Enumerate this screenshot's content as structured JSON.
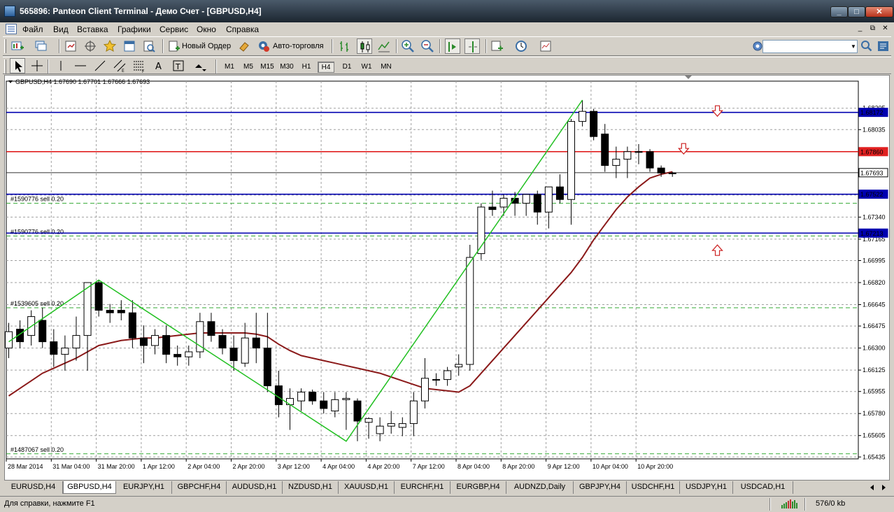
{
  "window": {
    "title": "565896: Panteon Client Terminal - Демо Счет - [GBPUSD,H4]",
    "minimize": "_",
    "maximize": "□",
    "close": "✕"
  },
  "menu": {
    "items": [
      "Файл",
      "Вид",
      "Вставка",
      "Графики",
      "Сервис",
      "Окно",
      "Справка"
    ],
    "mdi": {
      "minimize": "_",
      "restore": "⧉",
      "close": "✕"
    }
  },
  "toolbar": {
    "new_order": "Новый Ордер",
    "auto_trading": "Авто-торговля",
    "search_value": "",
    "timeframes": [
      "M1",
      "M5",
      "M15",
      "M30",
      "H1",
      "H4",
      "D1",
      "W1",
      "MN"
    ],
    "active_timeframe": "H4"
  },
  "chart": {
    "header": "GBPUSD,H4  1.67690 1.67701 1.67666 1.67693",
    "symbol": "GBPUSD",
    "timeframe": "H4",
    "ohlc": {
      "open": 1.6769,
      "high": 1.67701,
      "low": 1.67666,
      "close": 1.67693
    },
    "colors": {
      "bull": "#ffffff",
      "bear": "#000000",
      "ma": "#8b1a1a",
      "zigzag": "#22c022",
      "blue_level": "#0000b0",
      "red_level": "#e02020",
      "order_level": "#33aa33",
      "arrow": "#cc2222"
    },
    "y_min": 1.6542,
    "y_max": 1.6842,
    "price_ticks": [
      "1.68205",
      "1.68035",
      "1.67515",
      "1.67340",
      "1.67165",
      "1.66995",
      "1.66820",
      "1.66645",
      "1.66475",
      "1.66300",
      "1.66125",
      "1.65955",
      "1.65780",
      "1.65605",
      "1.65435"
    ],
    "time_labels": [
      "28 Mar 2014",
      "31 Mar 04:00",
      "31 Mar 20:00",
      "1 Apr 12:00",
      "2 Apr 04:00",
      "2 Apr 20:00",
      "3 Apr 12:00",
      "4 Apr 04:00",
      "4 Apr 20:00",
      "7 Apr 12:00",
      "8 Apr 04:00",
      "8 Apr 20:00",
      "9 Apr 12:00",
      "10 Apr 04:00",
      "10 Apr 20:00"
    ],
    "levels": [
      {
        "price": 1.68172,
        "label": "1.68172",
        "color": "#0000b0"
      },
      {
        "price": 1.6786,
        "label": "1.67860",
        "color": "#e02020"
      },
      {
        "price": 1.67693,
        "label": "1.67693",
        "color": "#333333"
      },
      {
        "price": 1.67522,
        "label": "1.67522",
        "color": "#0000b0"
      },
      {
        "price": 1.67213,
        "label": "1.67213",
        "color": "#0000b0"
      }
    ],
    "orders": [
      {
        "price": 1.6745,
        "label": "#1590776 sell 0.20"
      },
      {
        "price": 1.6719,
        "label": "#1590776 sell 0.20"
      },
      {
        "price": 1.6662,
        "label": "#1539605 sell 0.20"
      },
      {
        "price": 1.6546,
        "label": "#1487067 sell 0.20"
      }
    ],
    "arrows": [
      {
        "bar": 63,
        "price": 1.6818,
        "dir": "down"
      },
      {
        "bar": 60,
        "price": 1.6788,
        "dir": "down"
      },
      {
        "bar": 63,
        "price": 1.6708,
        "dir": "up"
      }
    ]
  },
  "chart_data": {
    "type": "candlestick",
    "candles": [
      [
        1.663,
        1.665,
        1.6622,
        1.6643
      ],
      [
        1.6645,
        1.6652,
        1.663,
        1.6635
      ],
      [
        1.664,
        1.666,
        1.6632,
        1.6655
      ],
      [
        1.6652,
        1.6662,
        1.663,
        1.6635
      ],
      [
        1.6635,
        1.6645,
        1.6615,
        1.6625
      ],
      [
        1.6625,
        1.664,
        1.6612,
        1.663
      ],
      [
        1.663,
        1.6655,
        1.662,
        1.664
      ],
      [
        1.664,
        1.668,
        1.6612,
        1.6682
      ],
      [
        1.6682,
        1.6684,
        1.6655,
        1.666
      ],
      [
        1.666,
        1.6665,
        1.665,
        1.6658
      ],
      [
        1.666,
        1.6668,
        1.6652,
        1.6658
      ],
      [
        1.6658,
        1.6668,
        1.663,
        1.6638
      ],
      [
        1.6638,
        1.6648,
        1.6618,
        1.6632
      ],
      [
        1.6632,
        1.6645,
        1.6625,
        1.664
      ],
      [
        1.664,
        1.6648,
        1.6618,
        1.6625
      ],
      [
        1.6625,
        1.6632,
        1.6616,
        1.6623
      ],
      [
        1.6623,
        1.6632,
        1.6616,
        1.6627
      ],
      [
        1.6627,
        1.6658,
        1.6622,
        1.6651
      ],
      [
        1.6651,
        1.6658,
        1.6635,
        1.664
      ],
      [
        1.664,
        1.6645,
        1.6625,
        1.663
      ],
      [
        1.663,
        1.664,
        1.6612,
        1.662
      ],
      [
        1.6618,
        1.665,
        1.6615,
        1.6638
      ],
      [
        1.6638,
        1.6658,
        1.6618,
        1.663
      ],
      [
        1.663,
        1.6658,
        1.6595,
        1.66
      ],
      [
        1.66,
        1.6612,
        1.6575,
        1.6585
      ],
      [
        1.6585,
        1.6598,
        1.6565,
        1.659
      ],
      [
        1.6588,
        1.6598,
        1.658,
        1.6595
      ],
      [
        1.6595,
        1.6597,
        1.6585,
        1.6588
      ],
      [
        1.6588,
        1.6595,
        1.6578,
        1.6582
      ],
      [
        1.658,
        1.6595,
        1.6575,
        1.6589
      ],
      [
        1.6589,
        1.6595,
        1.6565,
        1.659
      ],
      [
        1.6588,
        1.659,
        1.6556,
        1.6572
      ],
      [
        1.6571,
        1.6575,
        1.6558,
        1.6574
      ],
      [
        1.6562,
        1.6575,
        1.6556,
        1.6568
      ],
      [
        1.6568,
        1.658,
        1.6562,
        1.657
      ],
      [
        1.6567,
        1.6575,
        1.656,
        1.657
      ],
      [
        1.657,
        1.6595,
        1.656,
        1.6588
      ],
      [
        1.6588,
        1.6622,
        1.6582,
        1.6606
      ],
      [
        1.6605,
        1.661,
        1.66,
        1.6605
      ],
      [
        1.6605,
        1.6615,
        1.66,
        1.6612
      ],
      [
        1.6615,
        1.6625,
        1.6608,
        1.6617
      ],
      [
        1.6617,
        1.6712,
        1.6612,
        1.6702
      ],
      [
        1.6705,
        1.6745,
        1.67,
        1.6742
      ],
      [
        1.6742,
        1.6755,
        1.6735,
        1.674
      ],
      [
        1.6742,
        1.6752,
        1.6735,
        1.6749
      ],
      [
        1.6749,
        1.6754,
        1.6735,
        1.6745
      ],
      [
        1.6745,
        1.6752,
        1.6735,
        1.6752
      ],
      [
        1.6752,
        1.6755,
        1.6728,
        1.6738
      ],
      [
        1.6738,
        1.6758,
        1.6725,
        1.6758
      ],
      [
        1.6758,
        1.6768,
        1.6745,
        1.6748
      ],
      [
        1.6748,
        1.6812,
        1.6728,
        1.681
      ],
      [
        1.681,
        1.6827,
        1.6806,
        1.6818
      ],
      [
        1.6818,
        1.682,
        1.6795,
        1.6798
      ],
      [
        1.68,
        1.6808,
        1.677,
        1.6775
      ],
      [
        1.6775,
        1.679,
        1.6765,
        1.678
      ],
      [
        1.678,
        1.679,
        1.6765,
        1.6786
      ],
      [
        1.6786,
        1.6792,
        1.6776,
        1.6786
      ],
      [
        1.6786,
        1.6788,
        1.677,
        1.6773
      ],
      [
        1.6773,
        1.6775,
        1.6766,
        1.6769
      ],
      [
        1.6769,
        1.677,
        1.6766,
        1.6769
      ]
    ],
    "ma": [
      1.6592,
      1.6598,
      1.6604,
      1.661,
      1.6614,
      1.6618,
      1.6622,
      1.6627,
      1.6632,
      1.6634,
      1.6636,
      1.6637,
      1.6638,
      1.6638,
      1.6639,
      1.664,
      1.6641,
      1.6642,
      1.6642,
      1.6642,
      1.6642,
      1.6642,
      1.6641,
      1.6639,
      1.6633,
      1.6628,
      1.6624,
      1.6622,
      1.662,
      1.6618,
      1.6616,
      1.6614,
      1.6612,
      1.661,
      1.6607,
      1.6604,
      1.6601,
      1.6598,
      1.6597,
      1.6596,
      1.6595,
      1.66,
      1.661,
      1.662,
      1.663,
      1.664,
      1.665,
      1.666,
      1.667,
      1.668,
      1.669,
      1.6702,
      1.6716,
      1.6728,
      1.674,
      1.675,
      1.6758,
      1.6765,
      1.6768,
      1.677
    ],
    "zigzag": [
      [
        0,
        1.6635
      ],
      [
        8,
        1.6684
      ],
      [
        30,
        1.6556
      ],
      [
        51,
        1.6827
      ]
    ]
  },
  "tabs": {
    "items": [
      "EURUSD,H4",
      "GBPUSD,H4",
      "EURJPY,H1",
      "GBPCHF,H4",
      "AUDUSD,H1",
      "NZDUSD,H1",
      "XAUUSD,H1",
      "EURCHF,H1",
      "EURGBP,H4",
      "AUDNZD,Daily",
      "GBPJPY,H4",
      "USDCHF,H1",
      "USDJPY,H1",
      "USDCAD,H1"
    ],
    "active": "GBPUSD,H4"
  },
  "status": {
    "help": "Для справки, нажмите F1",
    "traffic": "576/0 kb"
  }
}
